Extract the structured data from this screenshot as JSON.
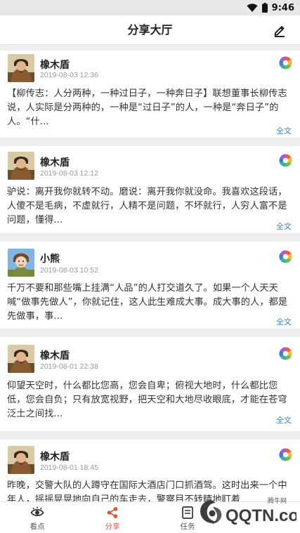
{
  "status": {
    "time": "9:46"
  },
  "header": {
    "title": "分享大厅",
    "edit_icon": "edit-pencil-icon"
  },
  "colors": {
    "accent": "#e0572f",
    "link": "#3a86c8"
  },
  "posts": [
    {
      "author": "橡木盾",
      "time": "2019-08-03 12:36",
      "content": "【柳传志：人分两种，一种过日子，一种奔日子】联想董事长柳传志说，人实际是分两种的，一种是“过日子”的人，一种是“奔日子”的人。“什...",
      "more": "全文",
      "avatar": "avatar-oak"
    },
    {
      "author": "橡木盾",
      "time": "2019-08-03 12:12",
      "content": "驴说：离开我你就转不动。磨说：离开我你就没命。我喜欢这段话，人傻不是毛病，不虚就行，人精不是问题，不坏就行，人穷人富不是问题，懂得...",
      "more": "全文",
      "avatar": "avatar-oak"
    },
    {
      "author": "小熊",
      "time": "2019-08-03 10:52",
      "content": "千万不要和那些嘴上挂满“人品”的人打交道久了。如果一个人天天喊“做事先做人”，你就记住，这人此生难成大事。成大事的人，都是先做事，事...",
      "more": "全文",
      "avatar": "avatar-bear"
    },
    {
      "author": "橡木盾",
      "time": "2019-08-01 22:38",
      "content": "仰望天空时，什么都比您高，您会自卑；俯视大地时，什么都比您低，您会自负；只有放宽视野，把天空和大地尽收眼底，才能在苍穹泛土之间找...",
      "more": "全文",
      "avatar": "avatar-oak"
    },
    {
      "author": "橡木盾",
      "time": "2019-08-01 18:45",
      "content": "昨晚，交警大队的人蹲守在国际大酒店门口抓酒驾。这时出来一个中年人，摇摇晃晃地向自己的车走去，警察目不转睛地盯着",
      "more": "",
      "avatar": "avatar-oak"
    }
  ],
  "tabs": [
    {
      "label": "看点",
      "icon": "eye-icon",
      "active": false
    },
    {
      "label": "分享",
      "icon": "share-icon",
      "active": true
    },
    {
      "label": "任务",
      "icon": "task-icon",
      "active": false
    }
  ],
  "watermark": {
    "text": "QQTN.com",
    "small": "腾牛网"
  }
}
